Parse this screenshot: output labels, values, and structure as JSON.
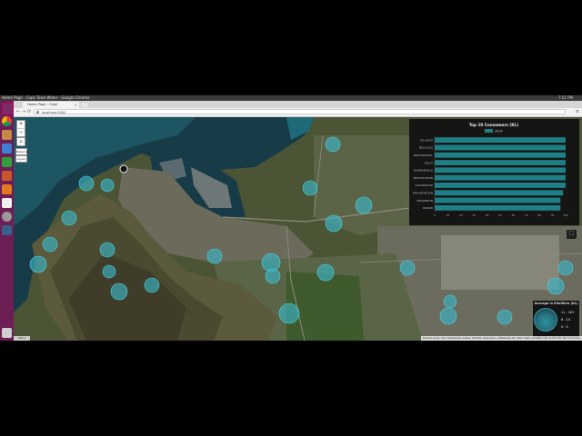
{
  "window": {
    "title": "Home Page - Cape Town Water - Google Chrome",
    "clock": "7:51 PM"
  },
  "browser": {
    "tab_title": "Home Page - Cape",
    "tab_close": "×",
    "url": "localhost:3000",
    "back": "←",
    "forward": "→",
    "reload": "⟳",
    "menu": "≡"
  },
  "launcher": {
    "items": [
      "dash-icon",
      "chrome-icon",
      "files-icon",
      "writer-icon",
      "calc-icon",
      "impress-icon",
      "software-center-icon",
      "amazon-icon",
      "settings-icon",
      "workspaces-icon",
      "trash-icon"
    ]
  },
  "map_controls": {
    "zoom_in": "+",
    "zoom_out": "−",
    "home": "⌂",
    "tool_1": "Basemap",
    "tool_2": "Layers",
    "fullscreen": "⛶"
  },
  "colors": {
    "bubble": "#3bb4c4",
    "bar": "#1f7f86",
    "panel": "#121212",
    "launcher": "#6d1e55"
  },
  "chart_data": {
    "type": "bar",
    "orientation": "horizontal",
    "title": "Top 10 Consumers (KL)",
    "legend": "2014",
    "legend_placement": "top",
    "categories": [
      "ATLANTIS",
      "BELLVILLE",
      "BRACKENFELL",
      "DELFT",
      "DURBANVILLE",
      "EERSTE RIVER",
      "GOODWOOD",
      "KRAAIFONTEIN",
      "MILNERTON",
      "PAROW"
    ],
    "values": [
      100,
      100,
      100,
      100,
      100,
      100,
      100,
      98,
      96,
      96
    ],
    "xlim": [
      0,
      100
    ],
    "xticks": [
      "0",
      "10",
      "20",
      "30",
      "40",
      "50",
      "60",
      "70",
      "80",
      "90",
      "100"
    ],
    "grid": false
  },
  "legend": {
    "title": "Average in Kilolitres (KL)",
    "rows": [
      "11 - 16+",
      "6 - 10",
      "0 - 5"
    ]
  },
  "attribution": "Powered by Esri | Esri, DigitalGlobe, GeoEye, Earthstar Geographics, CNES/Airbus DS, USDA, USGS, AeroGRID, IGN, and the GIS User Community",
  "scale": "500 m"
}
